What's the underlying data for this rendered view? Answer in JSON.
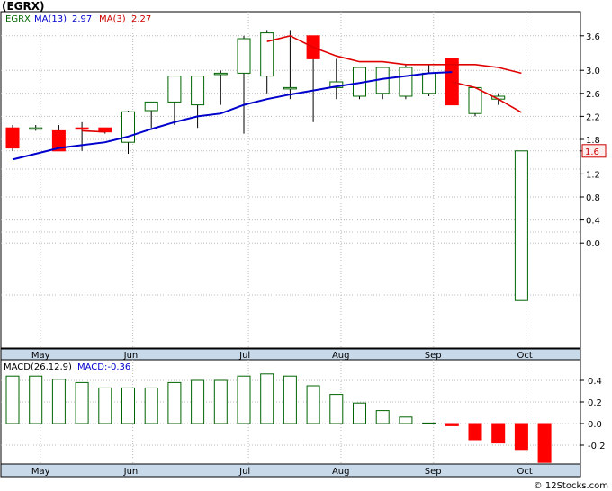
{
  "title": "(EGRX)",
  "credit": "© 12Stocks.com",
  "price_legend": {
    "symbol": "EGRX",
    "ma13": "MA(13)",
    "ma13_value": "2.97",
    "ma3": "MA(3)",
    "ma3_value": "2.27"
  },
  "macd_legend": {
    "label": "MACD(26,12,9)",
    "value": "MACD:-0.36"
  },
  "colors": {
    "up": "#006400",
    "down": "#ff0000",
    "ma13": "#0000cc",
    "ma3": "#e00000",
    "grid": "#bbbbbb"
  },
  "chart_data": [
    {
      "type": "candlestick",
      "months": [
        "May",
        "Jun",
        "Jul",
        "Aug",
        "Sep",
        "Oct"
      ],
      "month_week_index": [
        1.2,
        5.2,
        10.2,
        14.2,
        18.2,
        22.2
      ],
      "y_ticks": [
        0.0,
        0.4,
        0.8,
        1.2,
        1.6,
        1.8,
        2.2,
        2.6,
        3.0,
        3.6
      ],
      "last_price": "1.6",
      "ylim": [
        -1.0,
        3.8
      ],
      "candles": [
        {
          "o": 2.0,
          "h": 2.05,
          "l": 1.6,
          "c": 1.65
        },
        {
          "o": 2.0,
          "h": 2.05,
          "l": 1.95,
          "c": 2.0
        },
        {
          "o": 1.95,
          "h": 2.05,
          "l": 1.6,
          "c": 1.6
        },
        {
          "o": 2.0,
          "h": 2.1,
          "l": 1.6,
          "c": 1.98
        },
        {
          "o": 2.0,
          "h": 2.0,
          "l": 1.9,
          "c": 1.93
        },
        {
          "o": 1.75,
          "h": 2.3,
          "l": 1.55,
          "c": 2.28
        },
        {
          "o": 2.3,
          "h": 2.45,
          "l": 2.0,
          "c": 2.45
        },
        {
          "o": 2.45,
          "h": 2.9,
          "l": 2.05,
          "c": 2.9
        },
        {
          "o": 2.4,
          "h": 2.9,
          "l": 2.0,
          "c": 2.9
        },
        {
          "o": 2.95,
          "h": 3.0,
          "l": 2.4,
          "c": 2.95
        },
        {
          "o": 2.95,
          "h": 3.6,
          "l": 1.9,
          "c": 3.55
        },
        {
          "o": 2.9,
          "h": 3.7,
          "l": 2.6,
          "c": 3.65
        },
        {
          "o": 2.7,
          "h": 3.7,
          "l": 2.5,
          "c": 2.7
        },
        {
          "o": 3.6,
          "h": 3.6,
          "l": 2.1,
          "c": 3.2
        },
        {
          "o": 2.7,
          "h": 3.2,
          "l": 2.5,
          "c": 2.8
        },
        {
          "o": 2.55,
          "h": 3.05,
          "l": 2.5,
          "c": 3.05
        },
        {
          "o": 2.6,
          "h": 3.05,
          "l": 2.5,
          "c": 3.05
        },
        {
          "o": 2.55,
          "h": 3.1,
          "l": 2.5,
          "c": 3.05
        },
        {
          "o": 2.6,
          "h": 3.1,
          "l": 2.55,
          "c": 2.95
        },
        {
          "o": 3.2,
          "h": 3.2,
          "l": 2.4,
          "c": 2.4
        },
        {
          "o": 2.25,
          "h": 2.7,
          "l": 2.2,
          "c": 2.7
        },
        {
          "o": 2.5,
          "h": 2.6,
          "l": 2.4,
          "c": 2.55
        },
        {
          "o": -1.0,
          "h": 1.6,
          "l": -1.0,
          "c": 1.6
        }
      ],
      "ma13": [
        1.45,
        1.55,
        1.65,
        1.7,
        1.75,
        1.85,
        1.98,
        2.1,
        2.2,
        2.25,
        2.4,
        2.5,
        2.58,
        2.65,
        2.72,
        2.78,
        2.85,
        2.9,
        2.95,
        2.97
      ],
      "ma3": [
        null,
        null,
        null,
        1.95,
        1.93,
        null,
        null,
        null,
        null,
        null,
        null,
        3.5,
        3.6,
        3.4,
        3.25,
        3.15,
        3.15,
        3.1,
        3.1,
        3.1,
        3.1,
        3.05,
        2.95
      ],
      "ma3_tail": [
        {
          "i": 19,
          "v": 2.8
        },
        {
          "i": 20,
          "v": 2.7
        },
        {
          "i": 21,
          "v": 2.5
        },
        {
          "i": 22,
          "v": 2.27
        }
      ]
    },
    {
      "type": "bar",
      "name": "MACD(26,12,9)",
      "y_ticks": [
        0.4,
        0.2,
        0.0,
        -0.2
      ],
      "ylim": [
        -0.37,
        0.52
      ],
      "values": [
        0.44,
        0.44,
        0.41,
        0.38,
        0.33,
        0.33,
        0.33,
        0.38,
        0.4,
        0.4,
        0.44,
        0.46,
        0.44,
        0.35,
        0.27,
        0.19,
        0.12,
        0.06,
        0.005,
        -0.02,
        -0.15,
        -0.18,
        -0.24,
        -0.36
      ]
    }
  ]
}
